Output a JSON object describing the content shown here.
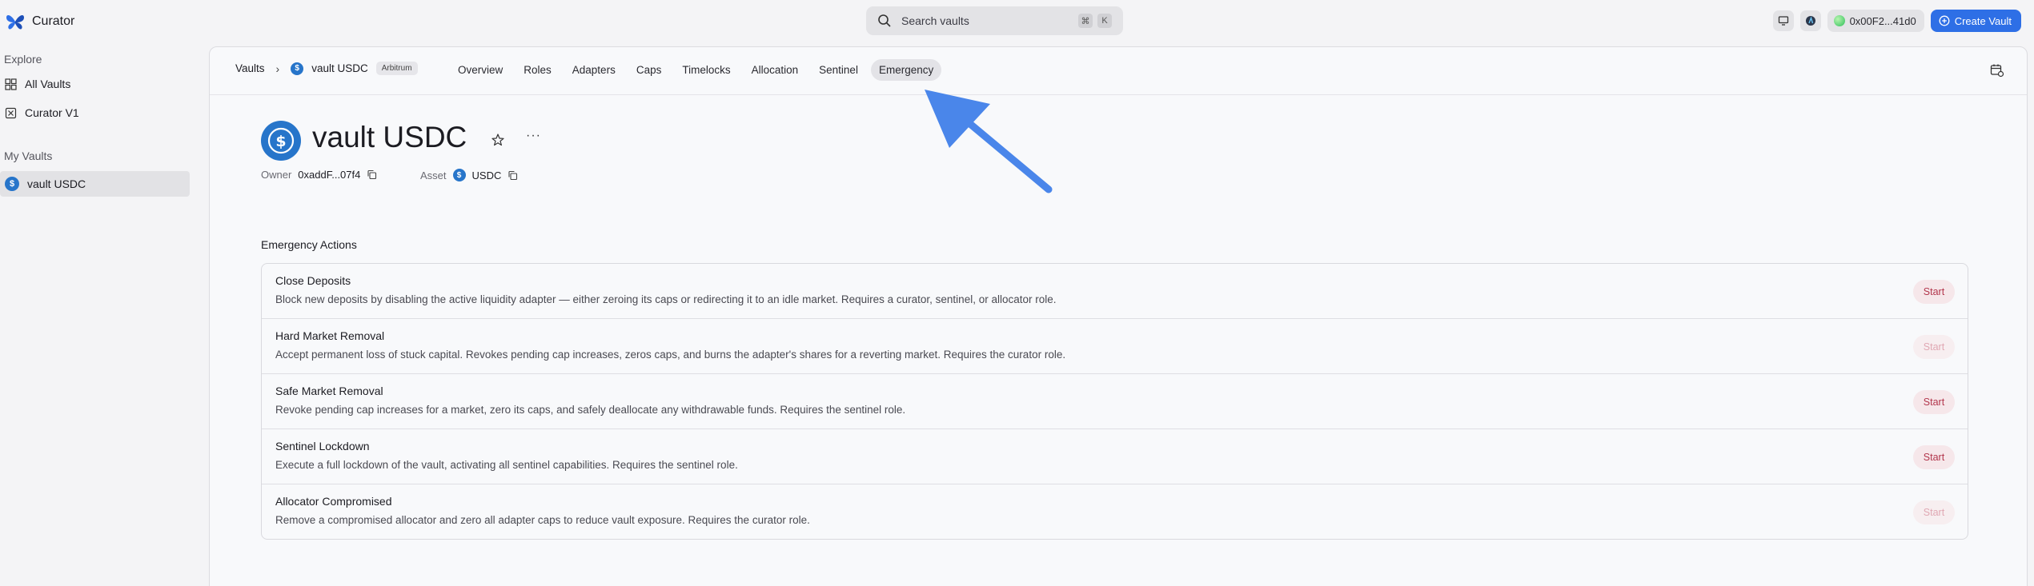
{
  "app": {
    "name": "Curator"
  },
  "search": {
    "placeholder": "Search vaults",
    "kbd1": "⌘",
    "kbd2": "K"
  },
  "wallet": {
    "address": "0x00F2...41d0"
  },
  "create_button": "Create Vault",
  "sidebar": {
    "explore_label": "Explore",
    "explore_items": [
      {
        "label": "All Vaults",
        "icon": "grid-icon"
      },
      {
        "label": "Curator V1",
        "icon": "box-x-icon"
      }
    ],
    "my_vaults_label": "My Vaults",
    "my_vaults_items": [
      {
        "label": "vault USDC",
        "icon": "usdc-icon",
        "active": true
      }
    ]
  },
  "breadcrumb": {
    "root": "Vaults",
    "vault": "vault USDC",
    "chain": "Arbitrum"
  },
  "tabs": [
    {
      "label": "Overview"
    },
    {
      "label": "Roles"
    },
    {
      "label": "Adapters"
    },
    {
      "label": "Caps"
    },
    {
      "label": "Timelocks"
    },
    {
      "label": "Allocation"
    },
    {
      "label": "Sentinel"
    },
    {
      "label": "Emergency",
      "active": true
    }
  ],
  "vault": {
    "title": "vault USDC",
    "more": "···",
    "owner_label": "Owner",
    "owner_value": "0xaddF...07f4",
    "asset_label": "Asset",
    "asset_value": "USDC"
  },
  "emergency": {
    "title": "Emergency Actions",
    "actions": [
      {
        "title": "Close Deposits",
        "description": "Block new deposits by disabling the active liquidity adapter — either zeroing its caps or redirecting it to an idle market. Requires a curator, sentinel, or allocator role.",
        "button": "Start",
        "enabled": true
      },
      {
        "title": "Hard Market Removal",
        "description": "Accept permanent loss of stuck capital. Revokes pending cap increases, zeros caps, and burns the adapter's shares for a reverting market. Requires the curator role.",
        "button": "Start",
        "enabled": false
      },
      {
        "title": "Safe Market Removal",
        "description": "Revoke pending cap increases for a market, zero its caps, and safely deallocate any withdrawable funds. Requires the sentinel role.",
        "button": "Start",
        "enabled": true
      },
      {
        "title": "Sentinel Lockdown",
        "description": "Execute a full lockdown of the vault, activating all sentinel capabilities. Requires the sentinel role.",
        "button": "Start",
        "enabled": true
      },
      {
        "title": "Allocator Compromised",
        "description": "Remove a compromised allocator and zero all adapter caps to reduce vault exposure. Requires the curator role.",
        "button": "Start",
        "enabled": false
      }
    ]
  },
  "colors": {
    "accent": "#2e6fe6",
    "usdc": "#2775ca",
    "start_text": "#b2364c",
    "annotation_arrow": "#4a86ea"
  }
}
